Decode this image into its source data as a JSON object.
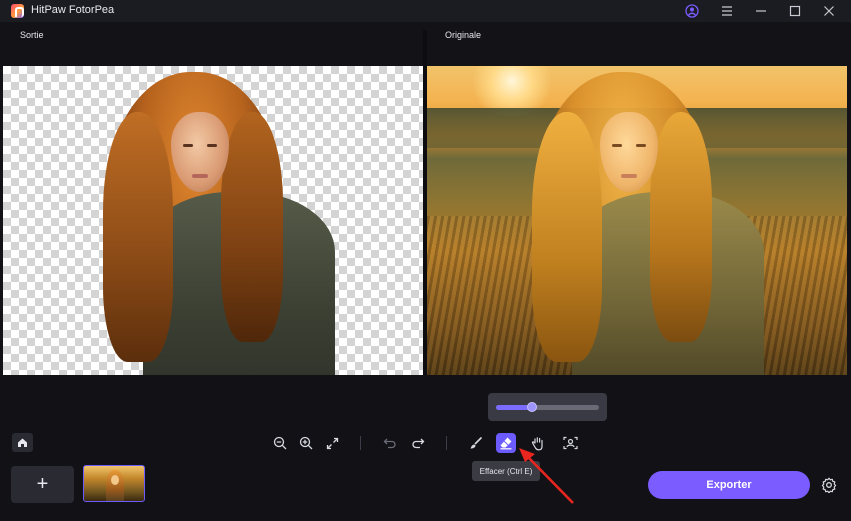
{
  "app": {
    "title": "HitPaw FotorPea"
  },
  "titlebar": {
    "icons": [
      "user-icon",
      "menu-icon",
      "minimize-icon",
      "maximize-icon",
      "close-icon"
    ]
  },
  "panels": {
    "left_label": "Sortie",
    "right_label": "Originale"
  },
  "toolbar": {
    "tools": [
      "zoom-out-icon",
      "zoom-in-icon",
      "fit-screen-icon",
      "undo-icon",
      "redo-icon",
      "brush-icon",
      "eraser-icon",
      "hand-icon",
      "portrait-icon"
    ],
    "active_tool": "eraser-icon",
    "brush_size_level": 0.35,
    "tooltip": "Effacer (Ctrl E)"
  },
  "bottom": {
    "export_label": "Exporter",
    "add_label": "+"
  },
  "colors": {
    "accent": "#7a5cff",
    "background": "#121217",
    "titlebar": "#1b1b22"
  }
}
